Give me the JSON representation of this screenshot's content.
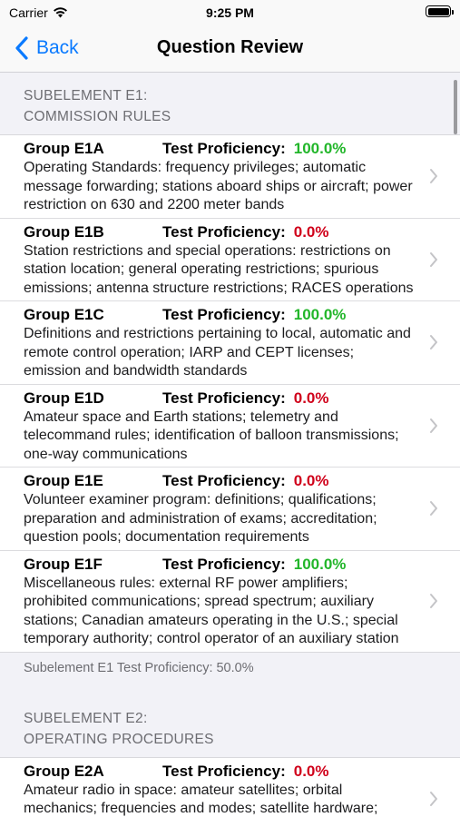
{
  "status_bar": {
    "carrier": "Carrier",
    "time": "9:25 PM"
  },
  "nav": {
    "back_label": "Back",
    "title": "Question Review"
  },
  "sections": [
    {
      "header_line1": "SUBELEMENT E1:",
      "header_line2": "COMMISSION RULES",
      "footer_label": "Subelement E1 Test Proficiency:",
      "footer_value": "50.0%",
      "groups": [
        {
          "name": "Group E1A",
          "prof_label": "Test Proficiency:",
          "prof_value": "100.0%",
          "status": "ok",
          "description": "Operating Standards: frequency privileges; automatic message forwarding; stations aboard ships or aircraft; power restriction on 630 and 2200 meter bands"
        },
        {
          "name": "Group E1B",
          "prof_label": "Test Proficiency:",
          "prof_value": "0.0%",
          "status": "bad",
          "description": "Station restrictions and special operations: restrictions on station location; general operating restrictions; spurious emissions; antenna structure restrictions; RACES operations"
        },
        {
          "name": "Group E1C",
          "prof_label": "Test Proficiency:",
          "prof_value": "100.0%",
          "status": "ok",
          "description": "Definitions and restrictions pertaining to local, automatic and remote control operation; IARP and CEPT licenses; emission and bandwidth standards"
        },
        {
          "name": "Group E1D",
          "prof_label": "Test Proficiency:",
          "prof_value": "0.0%",
          "status": "bad",
          "description": "Amateur space and Earth stations; telemetry and telecommand rules; identification of balloon transmissions; one-way communications"
        },
        {
          "name": "Group E1E",
          "prof_label": "Test Proficiency:",
          "prof_value": "0.0%",
          "status": "bad",
          "description": "Volunteer examiner program: definitions; qualifications; preparation and administration of exams; accreditation; question pools; documentation requirements"
        },
        {
          "name": "Group E1F",
          "prof_label": "Test Proficiency:",
          "prof_value": "100.0%",
          "status": "ok",
          "description": "Miscellaneous rules: external RF power amplifiers; prohibited communications; spread spectrum; auxiliary stations; Canadian amateurs operating in the U.S.; special temporary authority; control operator of an auxiliary station"
        }
      ]
    },
    {
      "header_line1": "SUBELEMENT E2:",
      "header_line2": "OPERATING PROCEDURES",
      "groups": [
        {
          "name": "Group E2A",
          "prof_label": "Test Proficiency:",
          "prof_value": "0.0%",
          "status": "bad",
          "description": "Amateur radio in space: amateur satellites; orbital mechanics; frequencies and modes; satellite hardware; satellite operations"
        }
      ]
    }
  ],
  "colors": {
    "accent": "#0a7aff",
    "proficient": "#22b62a",
    "not_proficient": "#d0021b"
  }
}
